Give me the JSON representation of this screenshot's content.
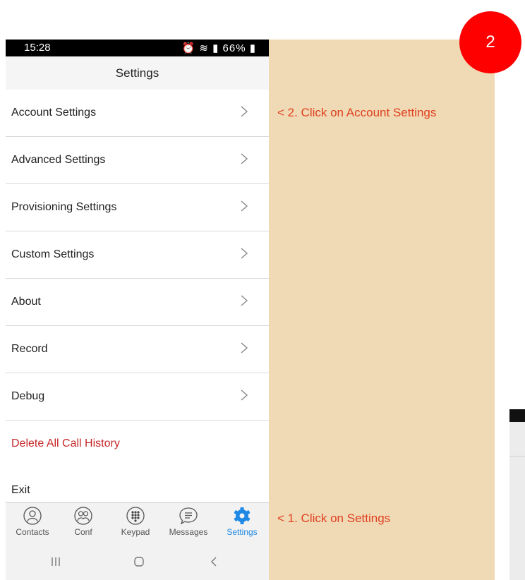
{
  "status": {
    "time": "15:28",
    "battery": "66%"
  },
  "title": "Settings",
  "menu": [
    {
      "label": "Account Settings",
      "chevron": true
    },
    {
      "label": "Advanced Settings",
      "chevron": true
    },
    {
      "label": "Provisioning Settings",
      "chevron": true
    },
    {
      "label": "Custom Settings",
      "chevron": true
    },
    {
      "label": "About",
      "chevron": true
    },
    {
      "label": "Record",
      "chevron": true
    },
    {
      "label": "Debug",
      "chevron": true
    },
    {
      "label": "Delete All Call History",
      "chevron": false,
      "color": "#c62828"
    },
    {
      "label": "Exit",
      "chevron": false
    }
  ],
  "tabs": [
    {
      "label": "Contacts",
      "icon": "contacts-icon"
    },
    {
      "label": "Conf",
      "icon": "conference-icon"
    },
    {
      "label": "Keypad",
      "icon": "keypad-icon"
    },
    {
      "label": "Messages",
      "icon": "messages-icon"
    },
    {
      "label": "Settings",
      "icon": "gear-icon",
      "active": true
    }
  ],
  "annotations": {
    "step2": "< 2. Click on Account Settings",
    "step1": "< 1. Click on Settings",
    "badge": "2"
  },
  "colors": {
    "accent": "#1e88e5",
    "annotation": "#e0401f",
    "badge": "#ff0000",
    "panel": "#f0d9b5"
  }
}
